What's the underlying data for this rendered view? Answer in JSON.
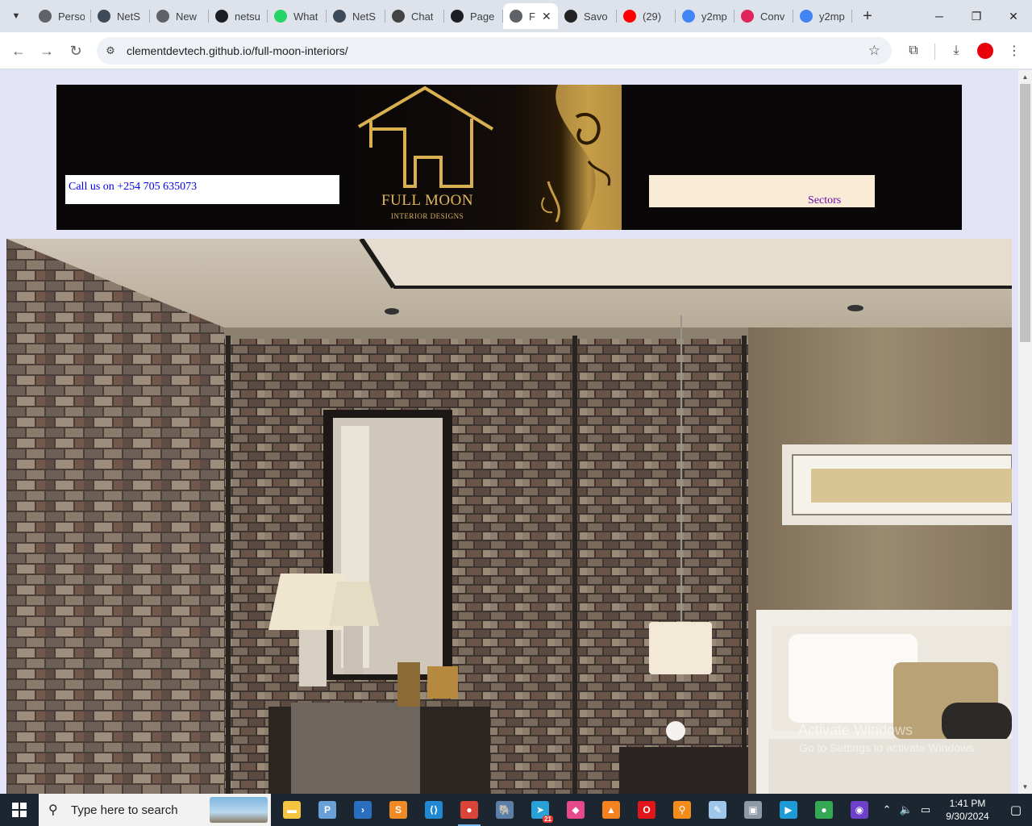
{
  "browser": {
    "tabs": [
      {
        "title": "Perso",
        "icon": "globe-icon",
        "color": "#5f6368"
      },
      {
        "title": "NetS",
        "icon": "netsuite-icon",
        "color": "#3c4a5a"
      },
      {
        "title": "New",
        "icon": "chrome-new-tab-icon",
        "color": "#5f6368"
      },
      {
        "title": "netsu",
        "icon": "github-icon",
        "color": "#1b1f23"
      },
      {
        "title": "What",
        "icon": "whatsapp-icon",
        "color": "#25d366"
      },
      {
        "title": "NetS",
        "icon": "netsuite-icon",
        "color": "#3c4a5a"
      },
      {
        "title": "Chat",
        "icon": "chatgpt-icon",
        "color": "#444"
      },
      {
        "title": "Page",
        "icon": "github-icon",
        "color": "#1b1f23"
      },
      {
        "title": "F",
        "icon": "globe-icon",
        "color": "#5f6368",
        "active": true
      },
      {
        "title": "Savo",
        "icon": "savo-icon",
        "color": "#222"
      },
      {
        "title": "(29)",
        "icon": "youtube-icon",
        "color": "#ff0000"
      },
      {
        "title": "y2mp",
        "icon": "google-icon",
        "color": "#4285f4"
      },
      {
        "title": "Conv",
        "icon": "download-icon",
        "color": "#e0245e"
      },
      {
        "title": "y2mp",
        "icon": "google-icon",
        "color": "#4285f4"
      }
    ],
    "url": "clementdevtech.github.io/full-moon-interiors/"
  },
  "page": {
    "call_text": "Call us on +254 705 635073",
    "logo_name": "FULL MOON",
    "logo_sub": "INTERIOR DESIGNS",
    "sectors_label": "Sectors",
    "hero_alt": "Bedroom with stone brick wall interior"
  },
  "watermark": {
    "line1": "Activate Windows",
    "line2": "Go to Settings to activate Windows."
  },
  "taskbar": {
    "search_placeholder": "Type here to search",
    "apps": [
      {
        "name": "file-explorer-icon",
        "color": "#f5c542",
        "glyph": "▬"
      },
      {
        "name": "file-icon",
        "color": "#6aa0d8",
        "glyph": "P"
      },
      {
        "name": "powershell-icon",
        "color": "#2a6fbf",
        "glyph": "›"
      },
      {
        "name": "sublime-icon",
        "color": "#f08a24",
        "glyph": "S"
      },
      {
        "name": "vscode-icon",
        "color": "#2189d1",
        "glyph": "⟨⟩"
      },
      {
        "name": "chrome-icon",
        "color": "#db4437",
        "glyph": "●",
        "running": true
      },
      {
        "name": "postgres-icon",
        "color": "#5b7fa8",
        "glyph": "🐘"
      },
      {
        "name": "telegram-icon",
        "color": "#2aa0d8",
        "glyph": "➤",
        "badge": "21"
      },
      {
        "name": "drop-icon",
        "color": "#e64a8b",
        "glyph": "◆"
      },
      {
        "name": "vlc-icon",
        "color": "#f58220",
        "glyph": "▲"
      },
      {
        "name": "opera-icon",
        "color": "#e0161b",
        "glyph": "O"
      },
      {
        "name": "search-app-icon",
        "color": "#f28c1b",
        "glyph": "⚲"
      },
      {
        "name": "paint-icon",
        "color": "#9fc7ea",
        "glyph": "✎"
      },
      {
        "name": "camera-icon",
        "color": "#8e9aa5",
        "glyph": "▣"
      },
      {
        "name": "screen-recorder-icon",
        "color": "#1e9ad6",
        "glyph": "▶"
      },
      {
        "name": "chrome-profile-icon",
        "color": "#34a853",
        "glyph": "●"
      },
      {
        "name": "github-desktop-icon",
        "color": "#6e40c9",
        "glyph": "◉"
      }
    ],
    "time": "1:41 PM",
    "date": "9/30/2024"
  }
}
